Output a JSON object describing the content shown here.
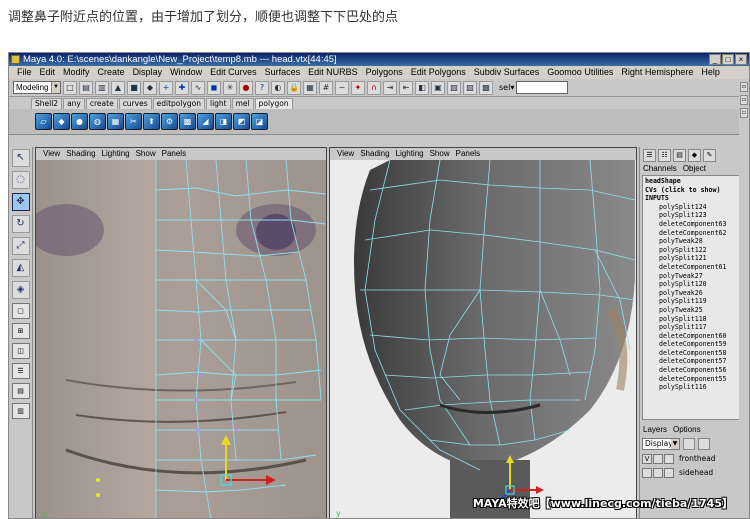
{
  "caption": "调整鼻子附近点的位置，由于增加了划分，顺便也调整下下巴处的点",
  "window": {
    "title": "Maya 4.0: E:\\scenes\\dankangle\\New_Project\\temp8.mb  ---  head.vtx[44:45]",
    "min": "_",
    "max": "□",
    "close": "×"
  },
  "menubar": [
    "File",
    "Edit",
    "Modify",
    "Create",
    "Display",
    "Window",
    "Edit Curves",
    "Surfaces",
    "Edit NURBS",
    "Polygons",
    "Edit Polygons",
    "Subdiv Surfaces",
    "Goomoo Utilities",
    "Right Hemisphere",
    "Help"
  ],
  "statusline": {
    "mode": "Modeling",
    "sel_label": "sel▾"
  },
  "shelf_tabs": [
    "Shell2",
    "any",
    "create",
    "curves",
    "editpolygon",
    "light",
    "mel",
    "polygon"
  ],
  "panels": {
    "left_menu": [
      "View",
      "Shading",
      "Lighting",
      "Show",
      "Panels"
    ],
    "right_menu": [
      "View",
      "Shading",
      "Lighting",
      "Show",
      "Panels"
    ]
  },
  "channel_box": {
    "tabs": [
      "Channels",
      "Object"
    ],
    "items": [
      {
        "text": "headShape",
        "indent": false
      },
      {
        "text": "CVs (click to show)",
        "indent": false
      },
      {
        "text": "INPUTS",
        "indent": false
      },
      {
        "text": "polySplit124",
        "indent": true
      },
      {
        "text": "polySplit123",
        "indent": true
      },
      {
        "text": "deleteComponent63",
        "indent": true
      },
      {
        "text": "deleteComponent62",
        "indent": true
      },
      {
        "text": "polyTweak28",
        "indent": true
      },
      {
        "text": "polySplit122",
        "indent": true
      },
      {
        "text": "polySplit121",
        "indent": true
      },
      {
        "text": "deleteComponent61",
        "indent": true
      },
      {
        "text": "polyTweak27",
        "indent": true
      },
      {
        "text": "polySplit120",
        "indent": true
      },
      {
        "text": "polyTweak26",
        "indent": true
      },
      {
        "text": "polySplit119",
        "indent": true
      },
      {
        "text": "polyTweak25",
        "indent": true
      },
      {
        "text": "polySplit118",
        "indent": true
      },
      {
        "text": "polySplit117",
        "indent": true
      },
      {
        "text": "deleteComponent60",
        "indent": true
      },
      {
        "text": "deleteComponent59",
        "indent": true
      },
      {
        "text": "deleteComponent58",
        "indent": true
      },
      {
        "text": "deleteComponent57",
        "indent": true
      },
      {
        "text": "deleteComponent56",
        "indent": true
      },
      {
        "text": "deleteComponent55",
        "indent": true
      },
      {
        "text": "polySplit116",
        "indent": true
      }
    ]
  },
  "layers": {
    "tabs": [
      "Layers",
      "Options"
    ],
    "dropdown": "Display",
    "rows": [
      {
        "vis": "V",
        "name": "fronthead"
      },
      {
        "vis": "",
        "name": "sidehead"
      }
    ]
  },
  "watermark": "MAYA特效吧【www.linecg.com/tieba/1745】"
}
